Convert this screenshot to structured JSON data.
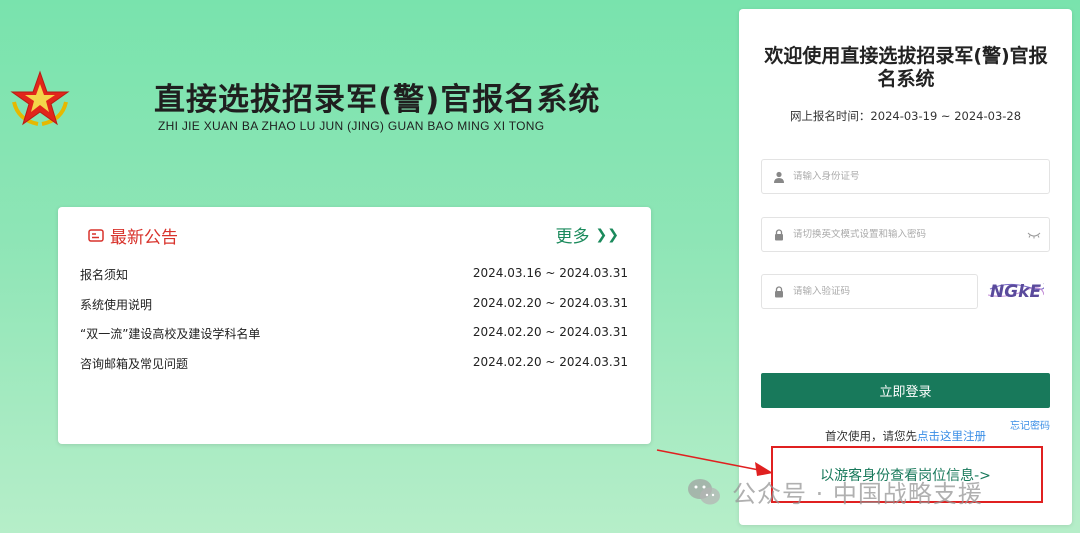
{
  "header": {
    "title": "直接选拔招录军(警)官报名系统",
    "pinyin": "ZHI JIE XUAN BA ZHAO LU JUN (JING) GUAN BAO MING XI TONG"
  },
  "notice": {
    "title": "最新公告",
    "more_label": "更多",
    "more_icon": "double-chevron-right",
    "items": [
      {
        "title": "报名须知",
        "date": "2024.03.16 ~ 2024.03.31"
      },
      {
        "title": "系统使用说明",
        "date": "2024.02.20 ~ 2024.03.31"
      },
      {
        "title": "“双一流”建设高校及建设学科名单",
        "date": "2024.02.20 ~ 2024.03.31"
      },
      {
        "title": "咨询邮箱及常见问题",
        "date": "2024.02.20 ~ 2024.03.31"
      }
    ]
  },
  "login": {
    "title": "欢迎使用直接选拔招录军(警)官报名系统",
    "reg_time": "网上报名时间：2024-03-19 ~ 2024-03-28",
    "id_placeholder": "请输入身份证号",
    "password_placeholder": "请切换英文模式设置和输入密码",
    "captcha_placeholder": "请输入验证码",
    "captcha_text": "NGkE",
    "login_button": "立即登录",
    "forgot_password": "忘记密码",
    "register_prefix": "首次使用，请您先",
    "register_link": "点击这里注册",
    "guest_link": "以游客身份查看岗位信息->"
  },
  "watermark": {
    "text": "公众号 · 中国战略支援"
  },
  "colors": {
    "accent": "#18795b",
    "notice_red": "#d8322b",
    "link_blue": "#3a8ee6",
    "highlight_red": "#e02020"
  }
}
